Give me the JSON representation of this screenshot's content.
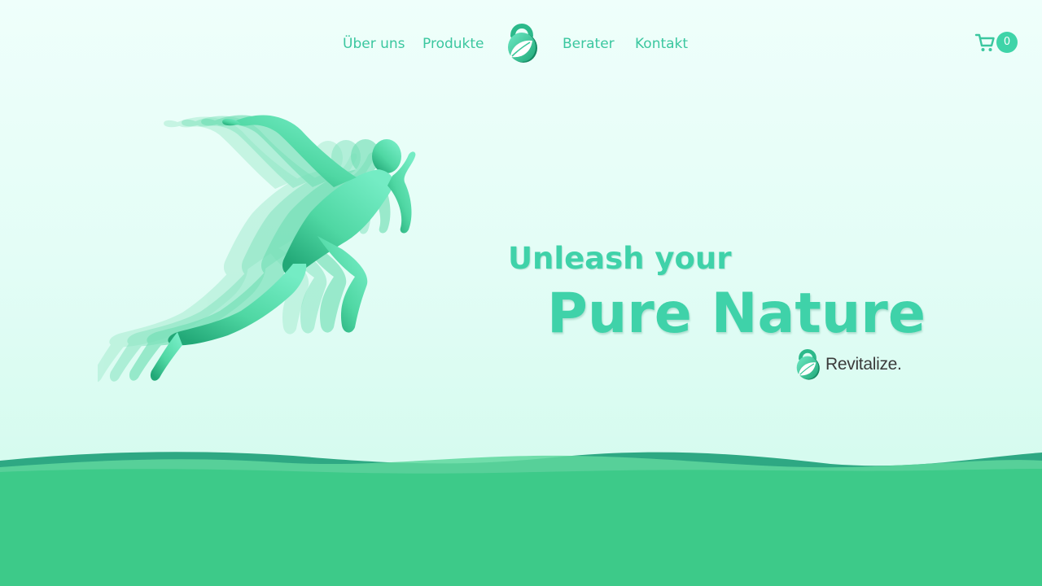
{
  "nav": {
    "left_links": [
      {
        "label": "Über uns"
      },
      {
        "label": "Produkte"
      }
    ],
    "right_links": [
      {
        "label": "Berater"
      },
      {
        "label": "Kontakt"
      }
    ],
    "logo_icon": "kettlebell-leaf-logo-icon"
  },
  "cart": {
    "icon": "cart-icon",
    "count": "0"
  },
  "hero": {
    "headline_line1": "Unleash your",
    "headline_line2": "Pure Nature",
    "illustration": "sprinting-runner-silhouette",
    "brand_icon": "kettlebell-leaf-logo-icon",
    "brand_name": "Revitalize."
  },
  "colors": {
    "accent": "#3fd2a9",
    "nav_text": "#3bc79f",
    "ground": "#3dca89",
    "wave_dark": "#2ea883",
    "wave_light": "#5ed79e",
    "background_top": "#effffb",
    "background_bottom": "#d2faec",
    "brand_text": "#3b3b3b"
  }
}
